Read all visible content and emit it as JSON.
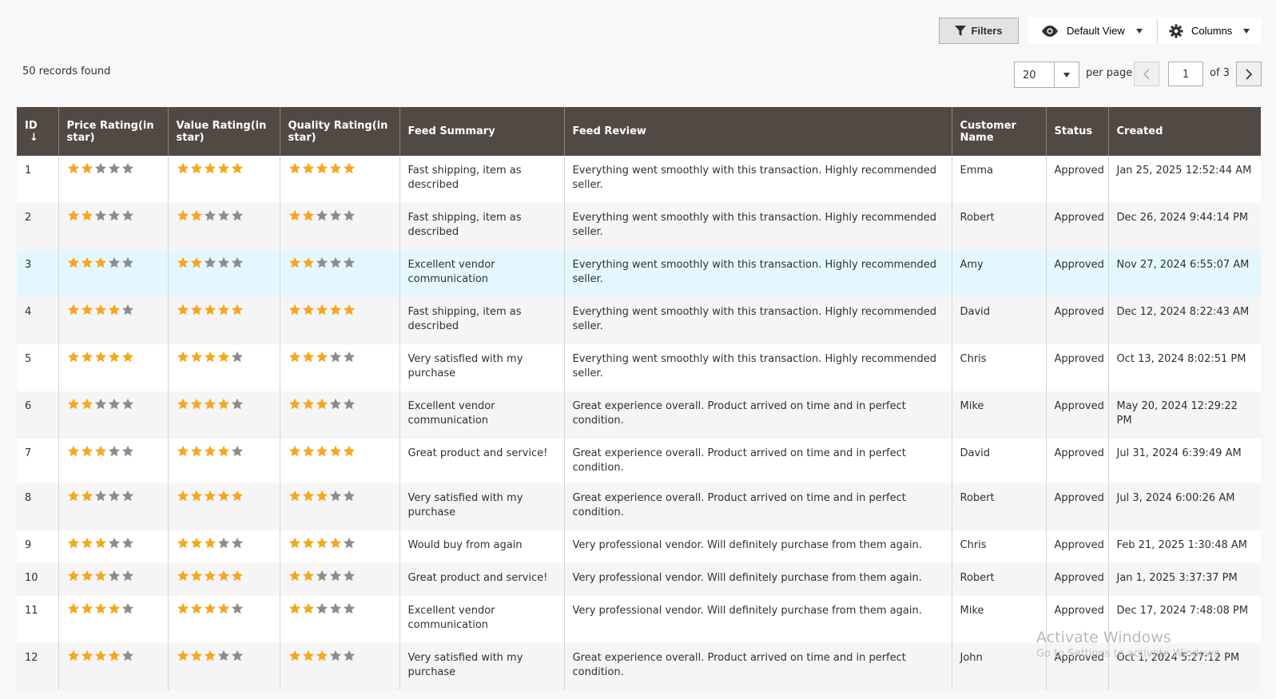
{
  "toolbar": {
    "filters_label": "Filters",
    "view_label": "Default View",
    "columns_label": "Columns"
  },
  "records_found": "50 records found",
  "pagination": {
    "per_page_value": "20",
    "per_page_label": "per page",
    "current_page": "1",
    "of_label": "of 3"
  },
  "columns": [
    "ID",
    "Price Rating(in star)",
    "Value Rating(in star)",
    "Quality Rating(in star)",
    "Feed Summary",
    "Feed Review",
    "Customer Name",
    "Status",
    "Created"
  ],
  "colors": {
    "header_bg": "#514943",
    "star_on": "#f7a61d",
    "star_off": "#8c8c8c",
    "highlight_row": "#e5f7fe"
  },
  "rows": [
    {
      "id": "1",
      "price": 2,
      "value": 5,
      "quality": 5,
      "summary": "Fast shipping, item as described",
      "review": "Everything went smoothly with this transaction. Highly recommended seller.",
      "customer": "Emma",
      "status": "Approved",
      "created": "Jan 25, 2025 12:52:44 AM"
    },
    {
      "id": "2",
      "price": 2,
      "value": 2,
      "quality": 2,
      "summary": "Fast shipping, item as described",
      "review": "Everything went smoothly with this transaction. Highly recommended seller.",
      "customer": "Robert",
      "status": "Approved",
      "created": "Dec 26, 2024 9:44:14 PM"
    },
    {
      "id": "3",
      "price": 3,
      "value": 2,
      "quality": 2,
      "summary": "Excellent vendor communication",
      "review": "Everything went smoothly with this transaction. Highly recommended seller.",
      "customer": "Amy",
      "status": "Approved",
      "created": "Nov 27, 2024 6:55:07 AM"
    },
    {
      "id": "4",
      "price": 4,
      "value": 5,
      "quality": 5,
      "summary": "Fast shipping, item as described",
      "review": "Everything went smoothly with this transaction. Highly recommended seller.",
      "customer": "David",
      "status": "Approved",
      "created": "Dec 12, 2024 8:22:43 AM"
    },
    {
      "id": "5",
      "price": 5,
      "value": 4,
      "quality": 3,
      "summary": "Very satisfied with my purchase",
      "review": "Everything went smoothly with this transaction. Highly recommended seller.",
      "customer": "Chris",
      "status": "Approved",
      "created": "Oct 13, 2024 8:02:51 PM"
    },
    {
      "id": "6",
      "price": 2,
      "value": 4,
      "quality": 3,
      "summary": "Excellent vendor communication",
      "review": "Great experience overall. Product arrived on time and in perfect condition.",
      "customer": "Mike",
      "status": "Approved",
      "created": "May 20, 2024 12:29:22 PM"
    },
    {
      "id": "7",
      "price": 3,
      "value": 4,
      "quality": 5,
      "summary": "Great product and service!",
      "review": "Great experience overall. Product arrived on time and in perfect condition.",
      "customer": "David",
      "status": "Approved",
      "created": "Jul 31, 2024 6:39:49 AM"
    },
    {
      "id": "8",
      "price": 2,
      "value": 5,
      "quality": 3,
      "summary": "Very satisfied with my purchase",
      "review": "Great experience overall. Product arrived on time and in perfect condition.",
      "customer": "Robert",
      "status": "Approved",
      "created": "Jul 3, 2024 6:00:26 AM"
    },
    {
      "id": "9",
      "price": 3,
      "value": 3,
      "quality": 4,
      "summary": "Would buy from again",
      "review": "Very professional vendor. Will definitely purchase from them again.",
      "customer": "Chris",
      "status": "Approved",
      "created": "Feb 21, 2025 1:30:48 AM"
    },
    {
      "id": "10",
      "price": 3,
      "value": 5,
      "quality": 2,
      "summary": "Great product and service!",
      "review": "Very professional vendor. Will definitely purchase from them again.",
      "customer": "Robert",
      "status": "Approved",
      "created": "Jan 1, 2025 3:37:37 PM"
    },
    {
      "id": "11",
      "price": 4,
      "value": 4,
      "quality": 2,
      "summary": "Excellent vendor communication",
      "review": "Very professional vendor. Will definitely purchase from them again.",
      "customer": "Mike",
      "status": "Approved",
      "created": "Dec 17, 2024 7:48:08 PM"
    },
    {
      "id": "12",
      "price": 4,
      "value": 3,
      "quality": 3,
      "summary": "Very satisfied with my purchase",
      "review": "Great experience overall. Product arrived on time and in perfect condition.",
      "customer": "John",
      "status": "Approved",
      "created": "Oct 1, 2024 5:27:12 PM"
    }
  ],
  "watermark": {
    "title": "Activate Windows",
    "subtitle": "Go to Settings to activate Windows."
  }
}
